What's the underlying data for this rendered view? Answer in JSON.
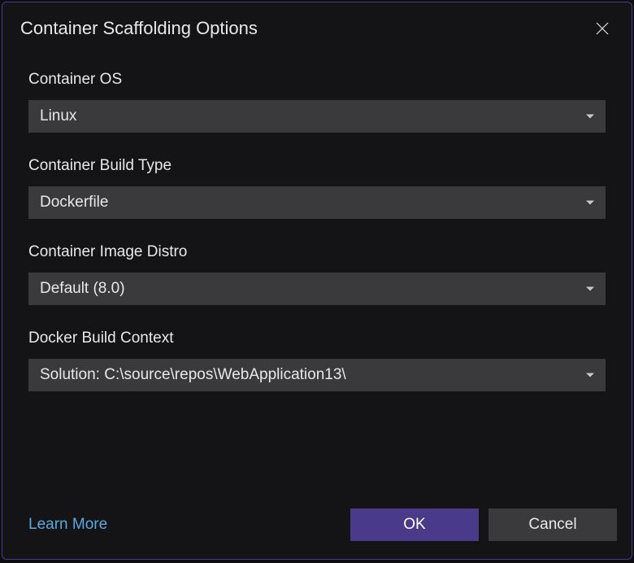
{
  "dialog": {
    "title": "Container Scaffolding Options"
  },
  "fields": {
    "container_os": {
      "label": "Container OS",
      "value": "Linux"
    },
    "build_type": {
      "label": "Container Build Type",
      "value": "Dockerfile"
    },
    "image_distro": {
      "label": "Container Image Distro",
      "value": "Default (8.0)"
    },
    "build_context": {
      "label": "Docker Build Context",
      "value": "Solution: C:\\source\\repos\\WebApplication13\\"
    }
  },
  "footer": {
    "learn_more": "Learn More",
    "ok": "OK",
    "cancel": "Cancel"
  }
}
